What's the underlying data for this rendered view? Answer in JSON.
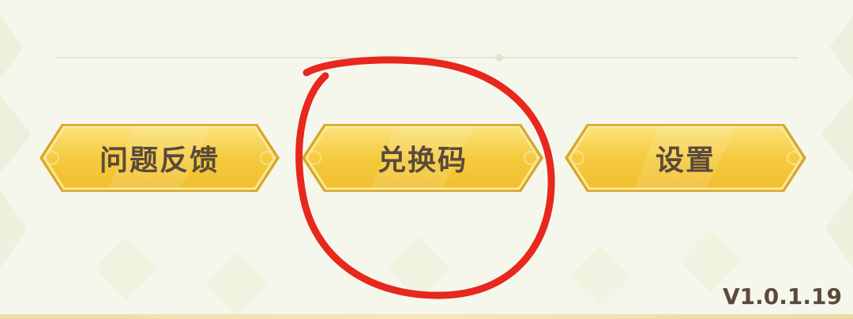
{
  "menu": {
    "buttons": [
      {
        "label": "问题反馈"
      },
      {
        "label": "兑换码"
      },
      {
        "label": "设置"
      }
    ]
  },
  "version": "V1.0.1.19",
  "colors": {
    "background": "#f6f7ec",
    "button_fill": "#f5cc3f",
    "button_border": "#fbe79a",
    "button_edge": "#d8a826",
    "label_text": "#5a4a3a",
    "annotation_circle": "#e8271e"
  }
}
